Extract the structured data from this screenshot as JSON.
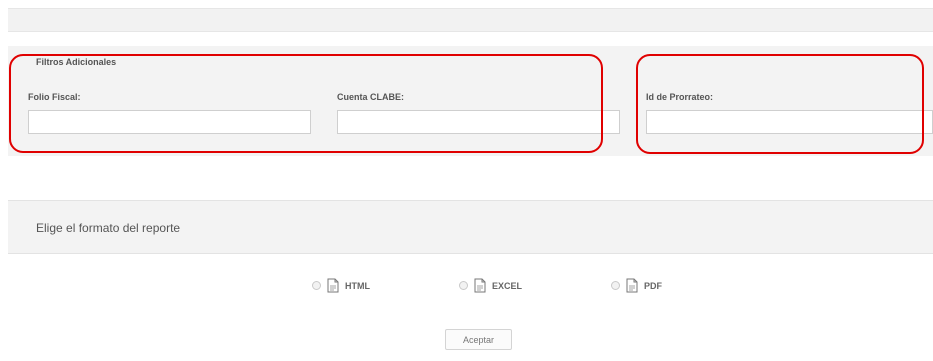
{
  "filters": {
    "title": "Filtros Adicionales",
    "fields": [
      {
        "label": "Folio Fiscal:",
        "value": ""
      },
      {
        "label": "Cuenta CLABE:",
        "value": ""
      },
      {
        "label": "Id de Prorrateo:",
        "value": ""
      }
    ]
  },
  "report_format": {
    "title": "Elige el formato del reporte",
    "options": [
      {
        "label": "HTML",
        "icon": "document-icon",
        "selected": false
      },
      {
        "label": "EXCEL",
        "icon": "document-icon",
        "selected": false
      },
      {
        "label": "PDF",
        "icon": "document-icon",
        "selected": false
      }
    ]
  },
  "actions": {
    "accept_label": "Aceptar"
  },
  "colors": {
    "highlight": "#e00000",
    "panel_background": "#f3f3f3",
    "input_border": "#cfcfcf"
  }
}
